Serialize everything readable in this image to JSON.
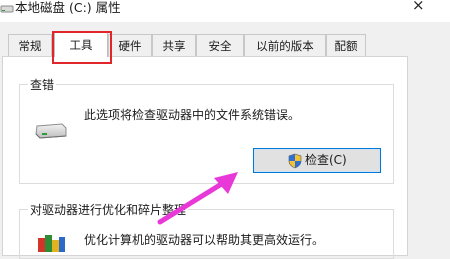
{
  "window": {
    "title": "本地磁盘 (C:) 属性",
    "close_symbol": "×"
  },
  "tabs": [
    {
      "label": "常规",
      "active": false
    },
    {
      "label": "工具",
      "active": true
    },
    {
      "label": "硬件",
      "active": false
    },
    {
      "label": "共享",
      "active": false
    },
    {
      "label": "安全",
      "active": false
    },
    {
      "label": "以前的版本",
      "active": false
    },
    {
      "label": "配额",
      "active": false
    }
  ],
  "error_check": {
    "legend": "查错",
    "description": "此选项将检查驱动器中的文件系统错误。",
    "button_label": "检查(C)",
    "icon": "drive-icon",
    "button_icon": "uac-shield-icon"
  },
  "optimize": {
    "legend": "对驱动器进行优化和碎片整理",
    "description": "优化计算机的驱动器可以帮助其更高效运行。",
    "icon": "defrag-icon"
  },
  "annotations": {
    "highlight_color": "#e0262a",
    "arrow_color": "#e838d8"
  }
}
